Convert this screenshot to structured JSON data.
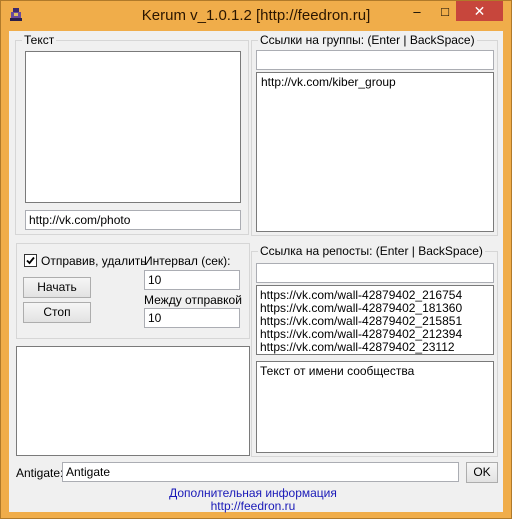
{
  "window": {
    "title": "Kerum v_1.0.1.2 [http://feedron.ru]"
  },
  "text_group": {
    "label": "Текст",
    "url_value": "http://vk.com/photo"
  },
  "control_group": {
    "checkbox_label": "Отправив, удалить",
    "checked": true,
    "start_label": "Начать",
    "stop_label": "Стоп",
    "interval_label": "Интервал (сек):",
    "interval_value": "10",
    "between_label": "Между отправкой",
    "between_value": "10"
  },
  "groups_panel": {
    "label": "Ссылки на группы: (Enter | BackSpace)",
    "input_value": "",
    "items": [
      "http://vk.com/kiber_group"
    ]
  },
  "reposts_panel": {
    "label": "Ссылка на репосты: (Enter | BackSpace)",
    "input_value": "",
    "items": [
      "https://vk.com/wall-42879402_216754",
      "https://vk.com/wall-42879402_181360",
      "https://vk.com/wall-42879402_215851",
      "https://vk.com/wall-42879402_212394",
      "https://vk.com/wall-42879402_23112"
    ],
    "community_text": "Текст от имени сообщества"
  },
  "antigate": {
    "label": "Antigate:",
    "value": "Antigate",
    "ok_label": "OK"
  },
  "footer": {
    "info_link": "Дополнительная информация",
    "site_link": "http://feedron.ru"
  }
}
